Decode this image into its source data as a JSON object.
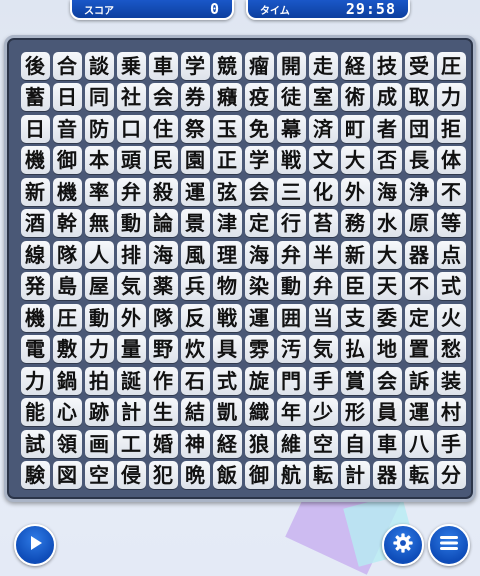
{
  "hud": {
    "score_label": "スコア",
    "score_value": "0",
    "time_label": "タイム",
    "time_value": "29:58"
  },
  "icons": {
    "play": "play-icon",
    "settings": "gear-icon",
    "menu": "menu-icon"
  },
  "colors": {
    "hud_blue": "#1552c0",
    "board_bg": "#4a5876",
    "tile_face": "#eef1f6",
    "button_blue": "#1a5fd0"
  },
  "board": {
    "rows": [
      [
        "後",
        "合",
        "談",
        "乗",
        "車",
        "学",
        "競",
        "瘤",
        "開",
        "走",
        "経",
        "技",
        "受",
        "圧"
      ],
      [
        "蓄",
        "日",
        "同",
        "社",
        "会",
        "券",
        "癪",
        "疫",
        "徒",
        "室",
        "術",
        "成",
        "取",
        "力"
      ],
      [
        "日",
        "音",
        "防",
        "口",
        "住",
        "祭",
        "玉",
        "免",
        "幕",
        "済",
        "町",
        "者",
        "団",
        "拒"
      ],
      [
        "機",
        "御",
        "本",
        "頭",
        "民",
        "園",
        "正",
        "学",
        "戦",
        "文",
        "大",
        "否",
        "長",
        "体"
      ],
      [
        "新",
        "機",
        "率",
        "弁",
        "殺",
        "運",
        "弦",
        "会",
        "三",
        "化",
        "外",
        "海",
        "浄",
        "不"
      ],
      [
        "酒",
        "幹",
        "無",
        "動",
        "論",
        "景",
        "津",
        "定",
        "行",
        "苔",
        "務",
        "水",
        "原",
        "等"
      ],
      [
        "線",
        "隊",
        "人",
        "排",
        "海",
        "風",
        "理",
        "海",
        "弁",
        "半",
        "新",
        "大",
        "器",
        "点"
      ],
      [
        "発",
        "島",
        "屋",
        "気",
        "薬",
        "兵",
        "物",
        "染",
        "動",
        "弁",
        "臣",
        "天",
        "不",
        "式"
      ],
      [
        "機",
        "圧",
        "動",
        "外",
        "隊",
        "反",
        "戦",
        "運",
        "囲",
        "当",
        "支",
        "委",
        "定",
        "火"
      ],
      [
        "電",
        "敷",
        "力",
        "量",
        "野",
        "炊",
        "具",
        "雰",
        "汚",
        "気",
        "払",
        "地",
        "置",
        "愁"
      ],
      [
        "力",
        "鍋",
        "拍",
        "誕",
        "作",
        "石",
        "式",
        "旋",
        "門",
        "手",
        "賞",
        "会",
        "訴",
        "装"
      ],
      [
        "能",
        "心",
        "跡",
        "計",
        "生",
        "結",
        "凱",
        "織",
        "年",
        "少",
        "形",
        "員",
        "運",
        "村"
      ],
      [
        "試",
        "領",
        "画",
        "工",
        "婚",
        "神",
        "経",
        "狼",
        "維",
        "空",
        "自",
        "車",
        "八",
        "手"
      ],
      [
        "験",
        "図",
        "空",
        "侵",
        "犯",
        "晩",
        "飯",
        "御",
        "航",
        "転",
        "計",
        "器",
        "転",
        "分"
      ]
    ]
  }
}
